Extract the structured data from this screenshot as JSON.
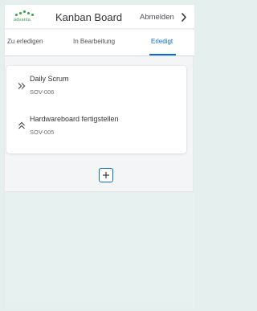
{
  "header": {
    "logo_text": "advanta",
    "title": "Kanban Board",
    "logout_label": "Abmelden",
    "logout_icon": "chevron-right-icon"
  },
  "tabs": [
    {
      "label": "Zu erledigen",
      "active": false
    },
    {
      "label": "In Bearbeitung",
      "active": false
    },
    {
      "label": "Erledigt",
      "active": true
    }
  ],
  "items": [
    {
      "name": "Daily Scrum",
      "id": "SOV-006",
      "icon": "double-chevron-right-icon"
    },
    {
      "name": "Hardwareboard fertigstellen",
      "id": "SOV-005",
      "icon": "double-chevron-up-icon"
    }
  ],
  "add_button": {
    "icon": "plus-icon"
  },
  "colors": {
    "accent": "#0a6ed1",
    "logo_green": "#28a745",
    "background": "#e5f0ee"
  }
}
